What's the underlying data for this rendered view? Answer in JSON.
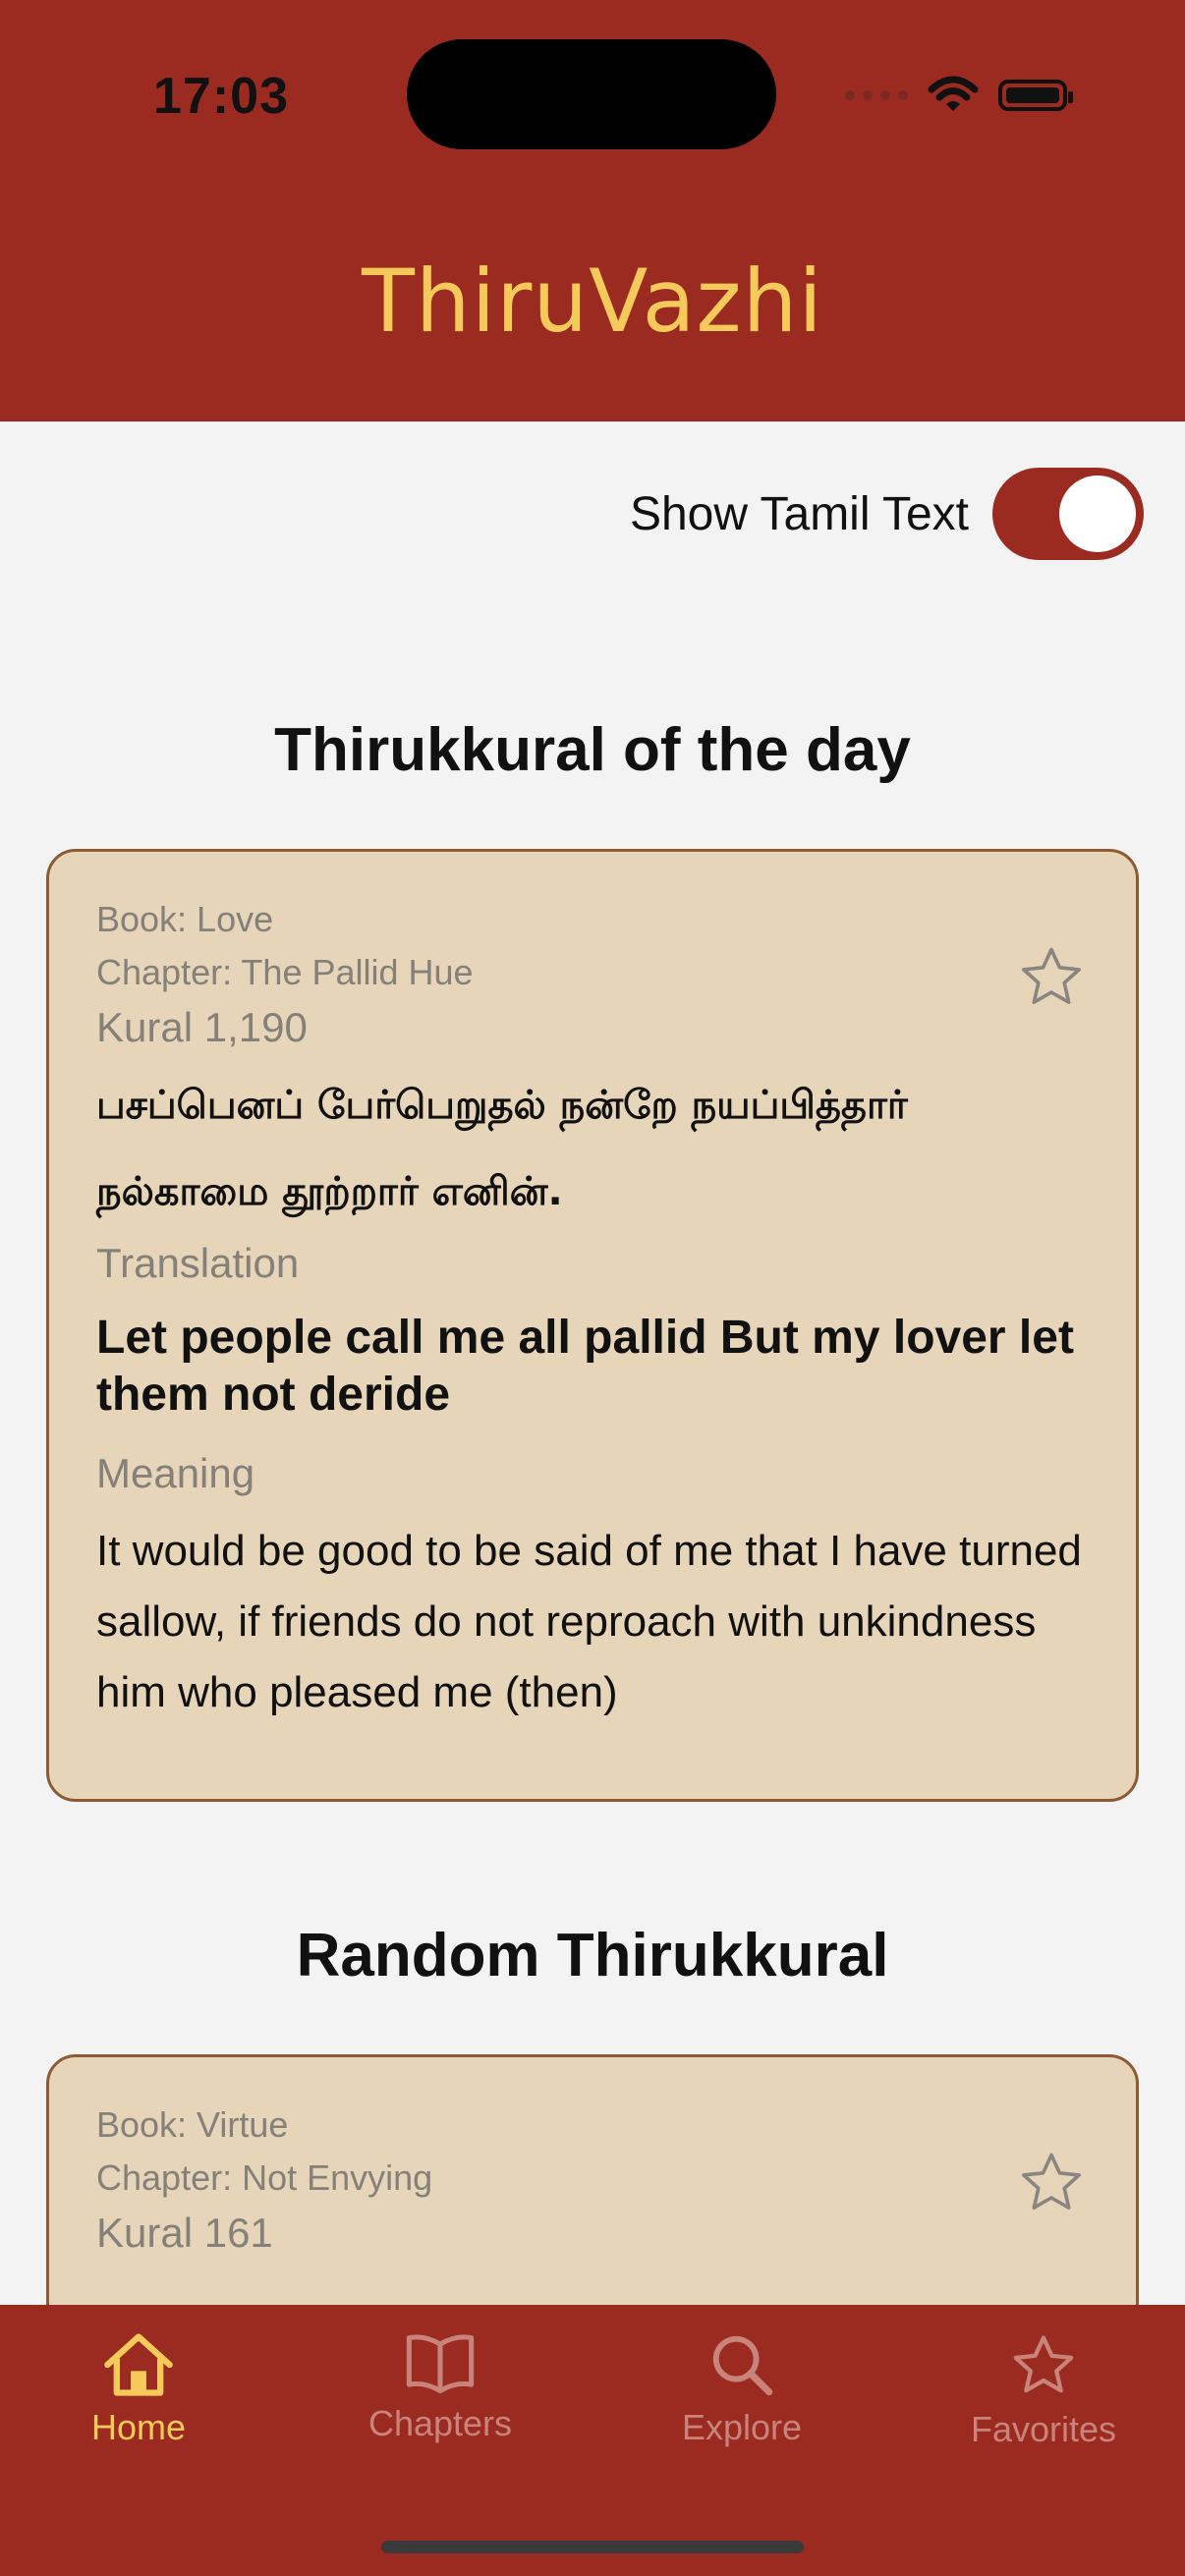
{
  "status_bar": {
    "time": "17:03"
  },
  "app": {
    "title": "ThiruVazhi"
  },
  "settings": {
    "show_tamil_label": "Show Tamil Text",
    "show_tamil_on": true
  },
  "sections": {
    "daily_title": "Thirukkural of the day",
    "random_title": "Random Thirukkural"
  },
  "daily_kural": {
    "book": "Book: Love",
    "chapter": "Chapter: The Pallid Hue",
    "number": "Kural 1,190",
    "tamil_line1": "பசப்பெனப் பேர்பெறுதல் நன்றே நயப்பித்தார்",
    "tamil_line2": "நல்காமை தூற்றார் எனின்.",
    "translation_label": "Translation",
    "translation": "Let people call me all pallid But my lover let them not deride",
    "meaning_label": "Meaning",
    "meaning": "It would be good to be said of me that I have turned sallow, if friends do not reproach with unkindness him who pleased me (then)"
  },
  "random_kural": {
    "book": "Book: Virtue",
    "chapter": "Chapter: Not Envying",
    "number": "Kural 161"
  },
  "tabs": [
    {
      "label": "Home",
      "icon": "house-icon",
      "active": true
    },
    {
      "label": "Chapters",
      "icon": "book-icon",
      "active": false
    },
    {
      "label": "Explore",
      "icon": "magnifier-icon",
      "active": false
    },
    {
      "label": "Favorites",
      "icon": "star-icon",
      "active": false
    }
  ],
  "colors": {
    "brand_red": "#9b2b21",
    "title_gold": "#f5c95a",
    "card_bg": "#e6d5b8",
    "card_border": "#8d5a34",
    "muted_text": "#85807a",
    "inactive_tab": "#c8847b"
  }
}
